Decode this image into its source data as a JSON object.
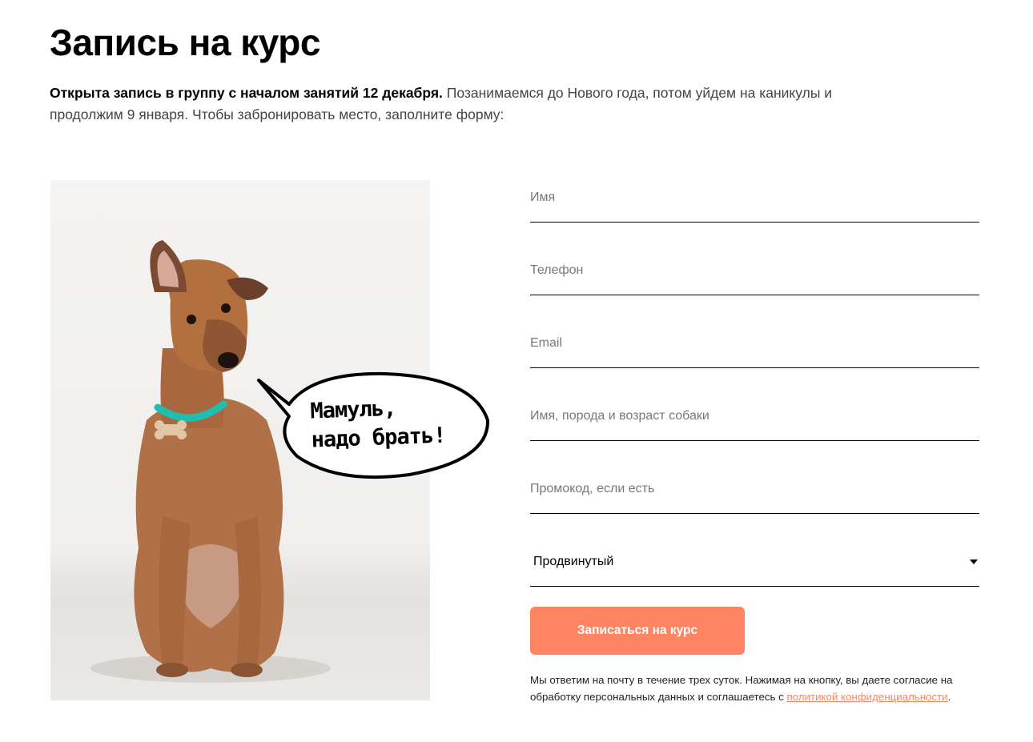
{
  "header": {
    "title": "Запись на курс",
    "intro_bold": "Открыта запись в группу с началом занятий 12 декабря.",
    "intro_rest": " Позанимаемся до Нового года, потом уйдем на каникулы и продолжим 9 января. Чтобы забронировать место, заполните форму:"
  },
  "image": {
    "subject": "dog-photo",
    "speech_bubble_line1": "Мамуль,",
    "speech_bubble_line2": "надо брать!"
  },
  "form": {
    "name_placeholder": "Имя",
    "phone_placeholder": "Телефон",
    "email_placeholder": "Email",
    "dog_placeholder": "Имя, порода и возраст собаки",
    "promo_placeholder": "Промокод, если есть",
    "level_selected": "Продвинутый",
    "submit_label": "Записаться на курс",
    "note_text": "Мы ответим на почту в течение трех суток. Нажимая на кнопку, вы даете согласие на обработку персональных данных и соглашаетесь с ",
    "note_link": "политикой конфиденциальности",
    "note_end": "."
  },
  "colors": {
    "accent": "#ff8562",
    "text": "#000000",
    "muted": "#444444"
  }
}
